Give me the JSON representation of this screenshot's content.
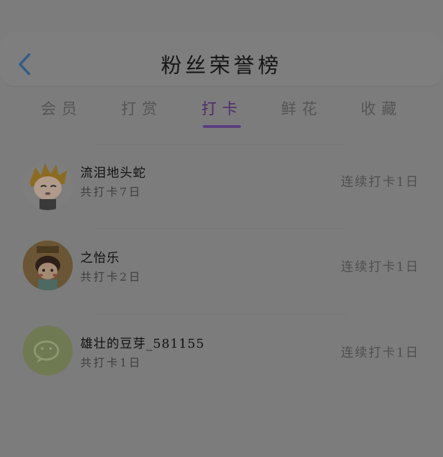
{
  "header": {
    "title": "粉丝荣誉榜",
    "back_icon": "chevron-left-icon",
    "accent": "#5b8fc9"
  },
  "tabs": [
    {
      "label": "会员",
      "active": false
    },
    {
      "label": "打赏",
      "active": false
    },
    {
      "label": "打卡",
      "active": true
    },
    {
      "label": "鲜花",
      "active": false
    },
    {
      "label": "收藏",
      "active": false
    }
  ],
  "list": [
    {
      "name": "流泪地头蛇",
      "total": "共打卡7日",
      "streak": "连续打卡1日",
      "avatar": "anime-boy-avatar"
    },
    {
      "name": "之怡乐",
      "total": "共打卡2日",
      "streak": "连续打卡1日",
      "avatar": "cartoon-girl-avatar"
    },
    {
      "name": "雄壮的豆芽_581155",
      "total": "共打卡1日",
      "streak": "连续打卡1日",
      "avatar": "wechat-default-avatar"
    }
  ]
}
